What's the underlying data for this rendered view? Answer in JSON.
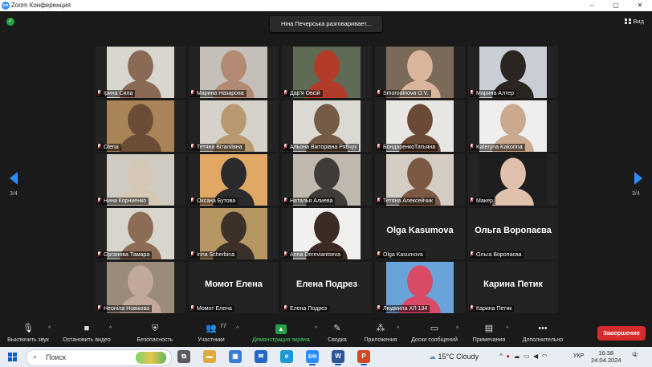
{
  "window": {
    "title": "Zoom Конференция",
    "logo_text": "zm",
    "controls": [
      "–",
      "▢",
      "✕"
    ]
  },
  "meeting": {
    "speaker_banner": "Ніна Печерська разговаривает...",
    "view_label": "Вид",
    "page_left": "3/4",
    "page_right": "3/4",
    "tiles": [
      {
        "name": "Ірина Сила",
        "type": "video",
        "bg": "#d9d6cf",
        "person": "#8a6a55"
      },
      {
        "name": "Марина Назарова",
        "type": "video",
        "bg": "#c4c0b9",
        "person": "#b28a74"
      },
      {
        "name": "Дар'я Овсій",
        "type": "video",
        "bg": "#5f6b55",
        "person": "#b33b2a"
      },
      {
        "name": "Smorodinova O.V.",
        "type": "video",
        "bg": "#7a6a5a",
        "person": "#d9b59c"
      },
      {
        "name": "Марина Алтер",
        "type": "video",
        "bg": "#c8cdd6",
        "person": "#2b2522"
      },
      {
        "name": "Olena",
        "type": "video",
        "bg": "#a88458",
        "person": "#6b4d36"
      },
      {
        "name": "Тетяна Віталіївна",
        "type": "video",
        "bg": "#d6d2c9",
        "person": "#b99a70"
      },
      {
        "name": "Альона Вікторівна Рябчук",
        "type": "video",
        "bg": "#dcd9d4",
        "person": "#735b45"
      },
      {
        "name": "БондаренкоТатьяна",
        "type": "video",
        "bg": "#e8e6e2",
        "person": "#6a4a36"
      },
      {
        "name": "Kateryna Kakorina",
        "type": "video",
        "bg": "#eeeeee",
        "person": "#caa98f"
      },
      {
        "name": "Нина Корниенко",
        "type": "video",
        "bg": "#cfcac2",
        "person": "#d4c8b5"
      },
      {
        "name": "Оксана Бутова",
        "type": "video",
        "bg": "#e0a765",
        "person": "#2c2a2c"
      },
      {
        "name": "Наталья Алиева",
        "type": "video",
        "bg": "#bfb8ae",
        "person": "#3f3b38"
      },
      {
        "name": "Тетяна Алексейчик",
        "type": "video",
        "bg": "#d4cdc4",
        "person": "#7b5943"
      },
      {
        "name": "Макер",
        "type": "video",
        "bg": "#1e1e1e",
        "person": "#e0c1ad"
      },
      {
        "name": "Органова Тамара",
        "type": "video",
        "bg": "#d8d4ce",
        "person": "#8c6c55"
      },
      {
        "name": "Irina Scherbina",
        "type": "video",
        "bg": "#b69663",
        "person": "#3b3129"
      },
      {
        "name": "Anna Dereviantseva",
        "type": "video",
        "bg": "#f2f0ee",
        "person": "#3c2b25"
      },
      {
        "name": "Olga Kasumova",
        "type": "text",
        "display": "Olga Kasumova"
      },
      {
        "name": "Ольга Воропаєва",
        "type": "text",
        "display": "Ольга Воропаєва"
      },
      {
        "name": "Неоніла Новікова",
        "type": "video",
        "bg": "#9a8b7a",
        "person": "#c2a89a"
      },
      {
        "name": "Момот Елена",
        "type": "text",
        "display": "Момот Елена"
      },
      {
        "name": "Елена Подрез",
        "type": "text",
        "display": "Елена Подрез"
      },
      {
        "name": "Людмила ХЛ 134",
        "type": "video",
        "bg": "#6aa3d8",
        "person": "#d94a66"
      },
      {
        "name": "Карина Петик",
        "type": "text",
        "display": "Карина Петик"
      }
    ]
  },
  "toolbar": {
    "mute": {
      "label": "Выключить звук",
      "icon": "microphone-icon",
      "glyph": "🎙"
    },
    "video": {
      "label": "Остановить видео",
      "icon": "video-camera-icon",
      "glyph": "■"
    },
    "security": {
      "label": "Безопасность",
      "icon": "shield-icon",
      "glyph": "⛨"
    },
    "participants": {
      "label": "Участники",
      "icon": "participants-icon",
      "glyph": "👥",
      "count": "77"
    },
    "share": {
      "label": "Демонстрация экрана",
      "icon": "share-screen-icon",
      "glyph": "▲"
    },
    "summary": {
      "label": "Сводка",
      "icon": "summary-icon",
      "glyph": "✎"
    },
    "apps": {
      "label": "Приложения",
      "icon": "apps-icon",
      "glyph": "⁂"
    },
    "whiteboards": {
      "label": "Доски сообщений",
      "icon": "whiteboard-icon",
      "glyph": "▭"
    },
    "notes": {
      "label": "Примечания",
      "icon": "notes-icon",
      "glyph": "▤"
    },
    "more": {
      "label": "Дополнительно",
      "icon": "more-icon",
      "glyph": "•••"
    },
    "end": {
      "label": "Завершение"
    }
  },
  "taskbar": {
    "search_placeholder": "Поиск",
    "weather": "15°C  Cloudy",
    "lang": "УКР",
    "time": "16:38",
    "date": "24.04.2024",
    "notifications": "4",
    "apps": [
      {
        "icon": "task-view-icon",
        "color": "#5a5a5a",
        "glyph": "⧉"
      },
      {
        "icon": "file-explorer-icon",
        "color": "#e2a93b",
        "glyph": "▬"
      },
      {
        "icon": "store-icon",
        "color": "#3a7bd5",
        "glyph": "▣"
      },
      {
        "icon": "mail-icon",
        "color": "#2467c6",
        "glyph": "✉"
      },
      {
        "icon": "edge-icon",
        "color": "#1d9bd1",
        "glyph": "e"
      },
      {
        "icon": "zoom-icon",
        "color": "#2d8cff",
        "glyph": "zm"
      },
      {
        "icon": "word-icon",
        "color": "#2b579a",
        "glyph": "W"
      },
      {
        "icon": "powerpoint-icon",
        "color": "#d24726",
        "glyph": "P"
      }
    ]
  }
}
